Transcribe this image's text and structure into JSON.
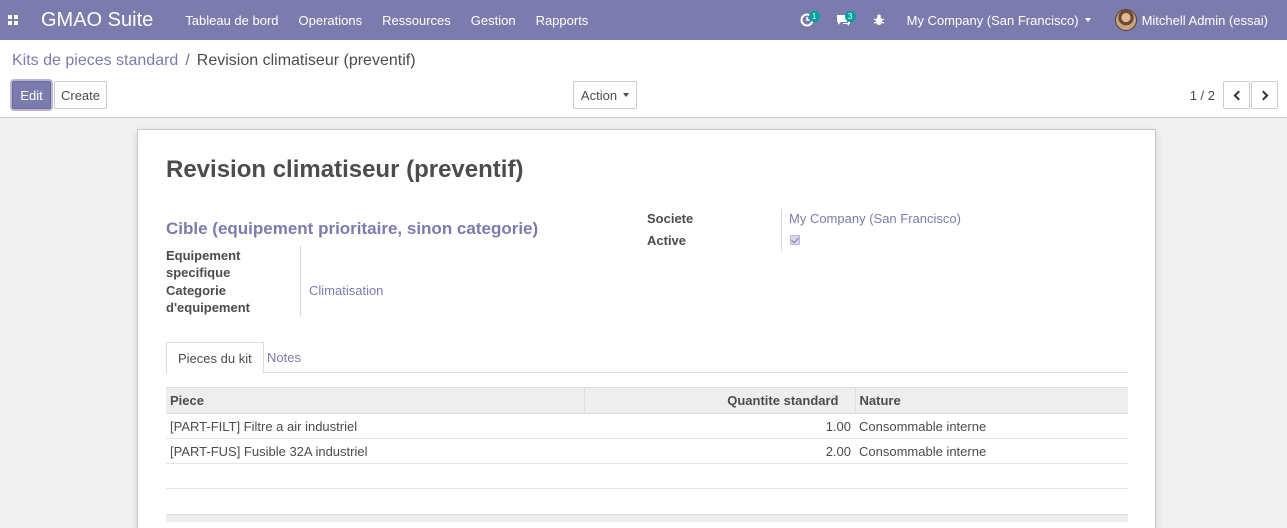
{
  "navbar": {
    "brand": "GMAO Suite",
    "menu": [
      "Tableau de bord",
      "Operations",
      "Ressources",
      "Gestion",
      "Rapports"
    ],
    "activity_count": "1",
    "message_count": "3",
    "company": "My Company (San Francisco)",
    "user": "Mitchell Admin (essai)",
    "accent_color": "#7c7bad",
    "badge_color": "#00a09d"
  },
  "breadcrumb": {
    "parent": "Kits de pieces standard",
    "separator": "/",
    "current": "Revision climatiseur (preventif)"
  },
  "buttons": {
    "edit": "Edit",
    "create": "Create",
    "action": "Action"
  },
  "pager": {
    "value": "1 / 2"
  },
  "record": {
    "title": "Revision climatiseur (preventif)",
    "group_title": "Cible (equipement prioritaire, sinon categorie)",
    "fields": {
      "equipement_label_1": "Equipement",
      "equipement_label_2": "specifique",
      "equipement_value": "",
      "categorie_label_1": "Categorie",
      "categorie_label_2": "d'equipement",
      "categorie_value": "Climatisation",
      "societe_label": "Societe",
      "societe_value": "My Company (San Francisco)",
      "active_label": "Active",
      "active_checked": true
    }
  },
  "tabs": [
    {
      "label": "Pieces du kit",
      "active": true
    },
    {
      "label": "Notes",
      "active": false
    }
  ],
  "table": {
    "columns": [
      "Piece",
      "Quantite standard",
      "Nature"
    ],
    "rows": [
      {
        "piece": "[PART-FILT] Filtre a air industriel",
        "qty": "1.00",
        "nature": "Consommable interne"
      },
      {
        "piece": "[PART-FUS] Fusible 32A industriel",
        "qty": "2.00",
        "nature": "Consommable interne"
      }
    ]
  }
}
